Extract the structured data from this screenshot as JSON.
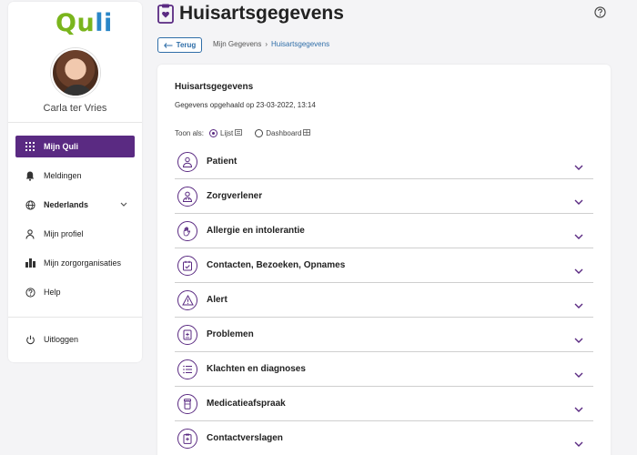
{
  "sidebar": {
    "logo": "Quli",
    "user_name": "Carla ter Vries",
    "items": [
      {
        "label": "Mijn Quli",
        "icon": "grid-icon",
        "active": true
      },
      {
        "label": "Meldingen",
        "icon": "bell-icon"
      },
      {
        "label": "Nederlands",
        "icon": "globe-icon"
      },
      {
        "label": "Mijn profiel",
        "icon": "user-icon"
      },
      {
        "label": "Mijn zorgorganisaties",
        "icon": "building-icon"
      },
      {
        "label": "Help",
        "icon": "help-icon"
      }
    ],
    "logout": "Uitloggen"
  },
  "header": {
    "title": "Huisartsgegevens",
    "back_label": "Terug",
    "breadcrumb": [
      "Mijn Gegevens",
      "Huisartsgegevens"
    ]
  },
  "card": {
    "title": "Huisartsgegevens",
    "fetched": "Gegevens opgehaald op 23-03-2022, 13:14",
    "view_label": "Toon als:",
    "view_options": [
      "Lijst",
      "Dashboard"
    ],
    "selected_view": "Lijst",
    "sections": [
      {
        "label": "Patient",
        "icon": "person-icon"
      },
      {
        "label": "Zorgverlener",
        "icon": "doctor-icon"
      },
      {
        "label": "Allergie en intolerantie",
        "icon": "hand-icon"
      },
      {
        "label": "Contacten, Bezoeken, Opnames",
        "icon": "calendar-check-icon"
      },
      {
        "label": "Alert",
        "icon": "warning-icon"
      },
      {
        "label": "Problemen",
        "icon": "medical-file-icon"
      },
      {
        "label": "Klachten en diagnoses",
        "icon": "list-icon"
      },
      {
        "label": "Medicatieafspraak",
        "icon": "pill-bottle-icon"
      },
      {
        "label": "Contactverslagen",
        "icon": "clipboard-icon"
      }
    ]
  },
  "colors": {
    "primary": "#5a2a82",
    "link": "#2f6ea8",
    "logo_green": "#7ab51d",
    "logo_blue": "#2a86c7"
  }
}
